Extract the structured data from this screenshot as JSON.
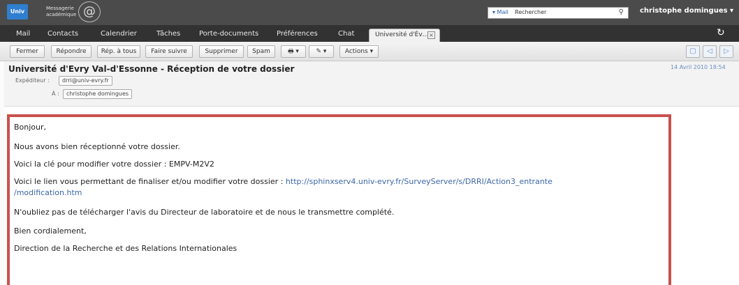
{
  "brand": {
    "logo_text": "Univ",
    "line1": "Messagerie",
    "line2": "académique",
    "at_symbol": "@"
  },
  "search": {
    "scope": "▾ Mail",
    "value": "Rechercher",
    "icon": "search-icon"
  },
  "user": {
    "name": "christophe domingues ▾"
  },
  "tabs": {
    "items": [
      {
        "label": "Mail"
      },
      {
        "label": "Contacts"
      },
      {
        "label": "Calendrier"
      },
      {
        "label": "Tâches"
      },
      {
        "label": "Porte-documents"
      },
      {
        "label": "Préférences"
      },
      {
        "label": "Chat"
      }
    ],
    "active": {
      "label": "Université d'Év…",
      "close": "×"
    },
    "refresh": "↻"
  },
  "toolbar": {
    "buttons": [
      {
        "label": "Fermer"
      },
      {
        "label": "Répondre"
      },
      {
        "label": "Rép. à tous"
      },
      {
        "label": "Faire suivre"
      },
      {
        "label": "Supprimer"
      },
      {
        "label": "Spam"
      },
      {
        "label": "🖶 ▾"
      },
      {
        "label": "✎ ▾"
      },
      {
        "label": "Actions ▾"
      }
    ],
    "view_buttons": [
      "▢",
      "◁",
      "▷"
    ]
  },
  "message": {
    "subject": "Université d'Evry Val-d'Essonne - Réception de votre dossier",
    "date": "14 Avril 2010 18:54",
    "from_label": "Expéditeur :",
    "from_value": "drri@univ-evry.fr",
    "to_label": "À :",
    "to_value": "christophe domingues"
  },
  "body": {
    "greeting": "Bonjour,",
    "line1": "Nous avons bien réceptionné votre dossier.",
    "line2": "Voici la clé pour modifier votre dossier : EMPV-M2V2",
    "line3_prefix": "Voici le lien vous permettant de finaliser et/ou modifier votre dossier : ",
    "link_part1": "http://sphinxserv4.univ-evry.fr/SurveyServer/s/DRRI/Action3_entrante",
    "link_part2": "/modification.htm",
    "line4": "N'oubliez pas de télécharger l'avis du Directeur de laboratoire et de nous le transmettre complété.",
    "closing": "Bien cordialement,",
    "signature": "Direction de la Recherche et des Relations Internationales"
  },
  "colors": {
    "highlight": "#c9514d",
    "link": "#3d67a8",
    "topbar": "#4b4b4b"
  }
}
